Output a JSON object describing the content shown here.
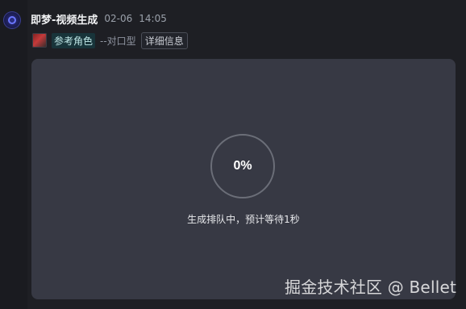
{
  "header": {
    "title": "即梦-视频生成",
    "date": "02-06",
    "time": "14:05"
  },
  "reference": {
    "label": "参考角色",
    "subtext": "--对口型",
    "detail_button": "详细信息"
  },
  "generation": {
    "progress_text": "0%",
    "status_text": "生成排队中，预计等待1秒"
  },
  "watermark": {
    "text": "掘金技术社区 @ Bellet"
  },
  "icons": {
    "avatar": "app-avatar-icon",
    "reference_thumb": "reference-image-icon"
  },
  "colors": {
    "background": "#1e1f24",
    "panel": "#373944",
    "accent_chip": "#18343a"
  }
}
